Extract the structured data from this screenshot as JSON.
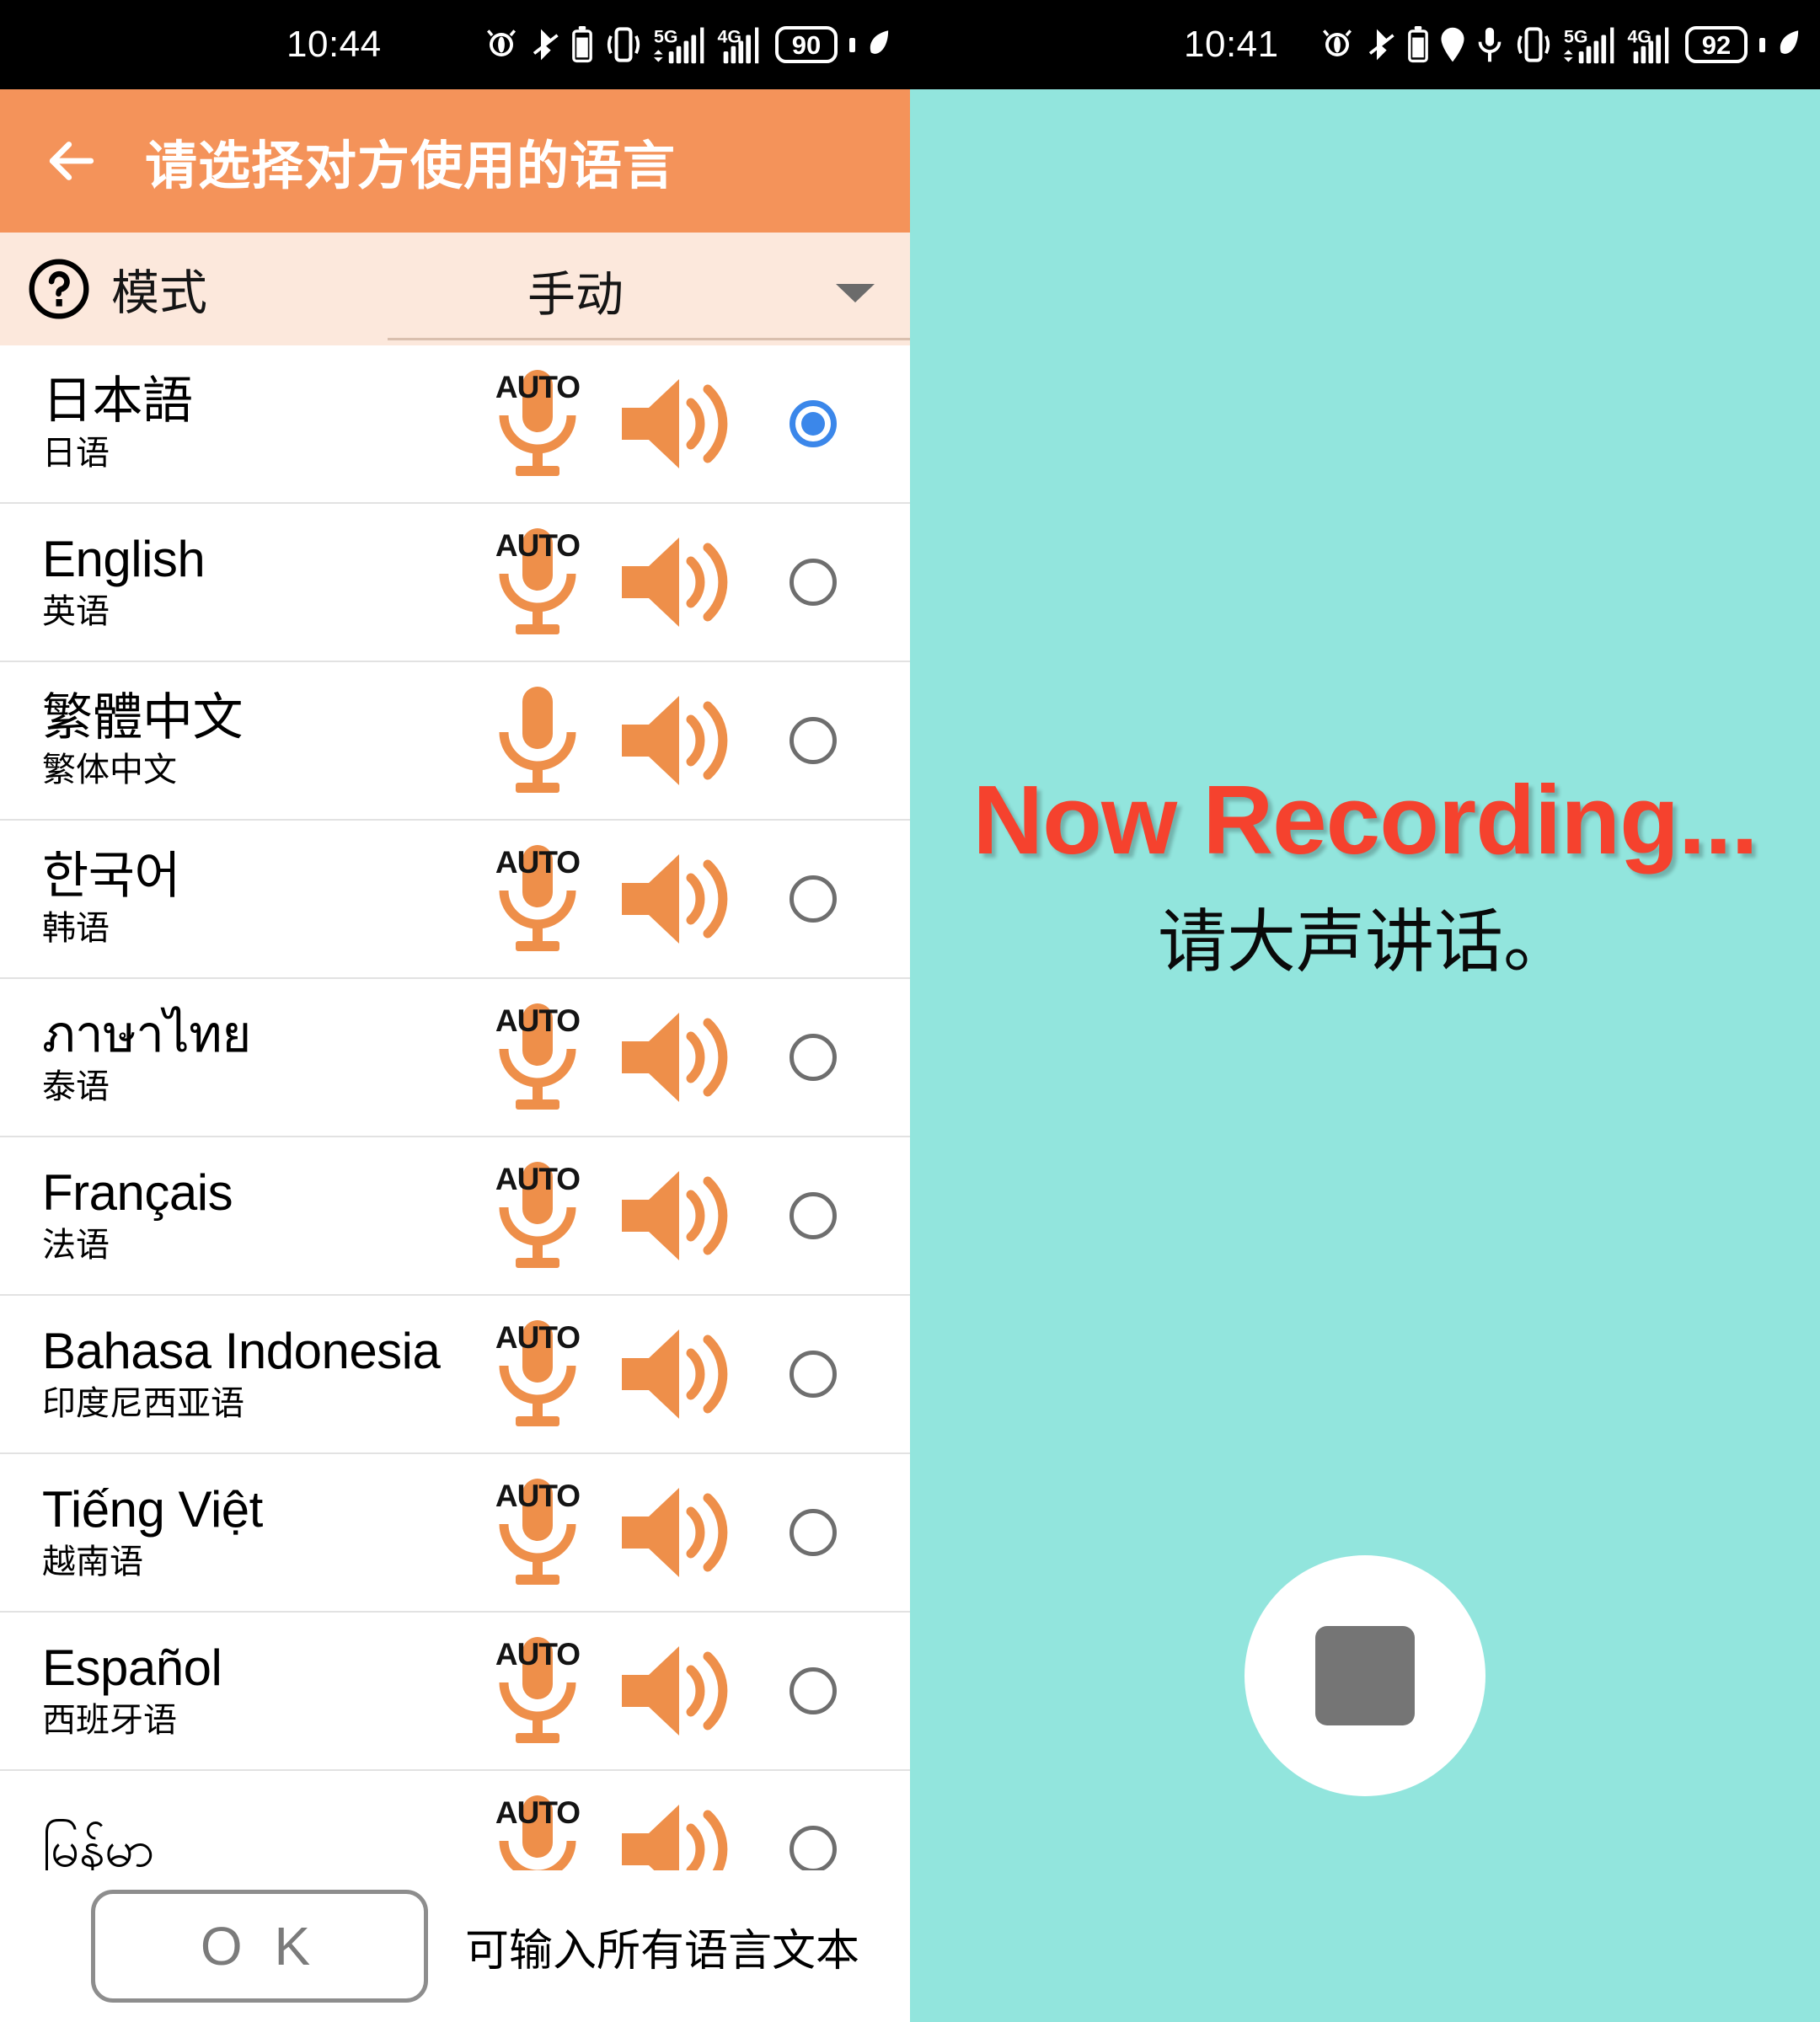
{
  "left_panel": {
    "status_bar": {
      "time": "10:44",
      "battery_percent": "90",
      "icons": [
        "alarm-off-icon",
        "bluetooth-off-icon",
        "vibrate-icon",
        "signal-5g-icon",
        "signal-4g-icon",
        "battery-icon",
        "power-saving-leaf-icon"
      ]
    },
    "app_bar": {
      "back_icon": "back-arrow-icon",
      "title": "请选择对方使用的语言"
    },
    "mode_row": {
      "help_icon": "question-mark-circle-icon",
      "label": "模式",
      "selected_value": "手动",
      "caret_icon": "chevron-down-icon"
    },
    "languages": [
      {
        "native": "日本語",
        "zh": "日语",
        "mic": "AUTO",
        "selected": true
      },
      {
        "native": "English",
        "zh": "英语",
        "mic": "AUTO",
        "selected": false
      },
      {
        "native": "繁體中文",
        "zh": "繁体中文",
        "mic": "",
        "selected": false
      },
      {
        "native": "한국어",
        "zh": "韩语",
        "mic": "AUTO",
        "selected": false
      },
      {
        "native": "ภาษาไทย",
        "zh": "泰语",
        "mic": "AUTO",
        "selected": false
      },
      {
        "native": "Français",
        "zh": "法语",
        "mic": "AUTO",
        "selected": false
      },
      {
        "native": "Bahasa Indonesia",
        "zh": "印度尼西亚语",
        "mic": "AUTO",
        "selected": false
      },
      {
        "native": "Tiếng Việt",
        "zh": "越南语",
        "mic": "AUTO",
        "selected": false
      },
      {
        "native": "Español",
        "zh": "西班牙语",
        "mic": "AUTO",
        "selected": false
      },
      {
        "native": "မြန်မာ",
        "zh": "",
        "mic": "AUTO",
        "selected": false
      }
    ],
    "footer": {
      "ok_label": "O K",
      "note": "可输入所有语言文本"
    }
  },
  "right_panel": {
    "status_bar": {
      "time": "10:41",
      "battery_percent": "92",
      "icons": [
        "alarm-off-icon",
        "bluetooth-battery-icon",
        "location-icon",
        "microphone-icon",
        "vibrate-icon",
        "signal-5g-icon",
        "signal-4g-icon",
        "battery-icon",
        "power-saving-leaf-icon"
      ]
    },
    "recording": {
      "title": "Now Recording...",
      "subtitle": "请大声讲话。",
      "stop_icon": "stop-square-icon"
    }
  },
  "colors": {
    "app_bar_orange": "#f4935a",
    "mode_bar_peach": "#fce8dc",
    "icon_orange": "#ee8f4a",
    "radio_blue": "#3b87ea",
    "recording_red": "#f5422e",
    "right_bg_teal": "#92e5dd",
    "stop_gray": "#757575"
  }
}
